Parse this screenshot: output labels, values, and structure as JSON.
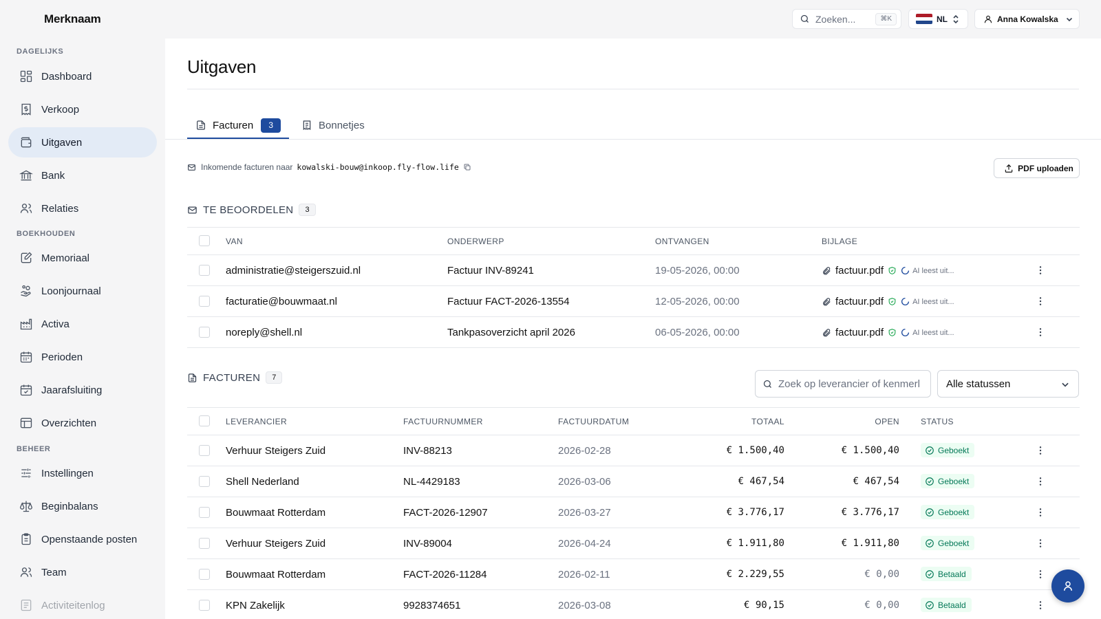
{
  "brand": "Merknaam",
  "topbar": {
    "search_placeholder": "Zoeken...",
    "search_shortcut": "⌘K",
    "language": "NL",
    "user_name": "Anna Kowalska"
  },
  "sidebar": {
    "sections": [
      {
        "title": "DAGELIJKS",
        "items": [
          {
            "label": "Dashboard",
            "icon": "dashboard-icon"
          },
          {
            "label": "Verkoop",
            "icon": "receipt-icon"
          },
          {
            "label": "Uitgaven",
            "icon": "wallet-icon",
            "active": true
          },
          {
            "label": "Bank",
            "icon": "bank-icon"
          },
          {
            "label": "Relaties",
            "icon": "users-icon"
          }
        ]
      },
      {
        "title": "BOEKHOUDEN",
        "items": [
          {
            "label": "Memoriaal",
            "icon": "journal-edit-icon"
          },
          {
            "label": "Loonjournaal",
            "icon": "hand-coins-icon"
          },
          {
            "label": "Activa",
            "icon": "factory-icon"
          },
          {
            "label": "Perioden",
            "icon": "calendar-icon"
          },
          {
            "label": "Jaarafsluiting",
            "icon": "calendar-check-icon"
          },
          {
            "label": "Overzichten",
            "icon": "table-icon"
          }
        ]
      },
      {
        "title": "BEHEER",
        "items": [
          {
            "label": "Instellingen",
            "icon": "sliders-icon"
          },
          {
            "label": "Beginbalans",
            "icon": "scale-icon"
          },
          {
            "label": "Openstaande posten",
            "icon": "clipboard-list-icon"
          },
          {
            "label": "Team",
            "icon": "team-icon"
          },
          {
            "label": "Activiteitenlog",
            "icon": "log-icon"
          }
        ]
      }
    ]
  },
  "page": {
    "title": "Uitgaven",
    "tabs": [
      {
        "label": "Facturen",
        "badge": "3",
        "active": true
      },
      {
        "label": "Bonnetjes"
      }
    ],
    "inbox_label": "Inkomende facturen naar",
    "inbox_email": "kowalski-bouw@inkoop.fly-flow.life",
    "upload_button": "PDF uploaden"
  },
  "review": {
    "title": "TE BEOORDELEN",
    "count": "3",
    "columns": [
      "VAN",
      "ONDERWERP",
      "ONTVANGEN",
      "BIJLAGE"
    ],
    "rows": [
      {
        "from": "administratie@steigerszuid.nl",
        "subject": "Factuur INV-89241",
        "received": "19-05-2026, 00:00",
        "file": "factuur.pdf",
        "ai": "AI leest uit..."
      },
      {
        "from": "facturatie@bouwmaat.nl",
        "subject": "Factuur FACT-2026-13554",
        "received": "12-05-2026, 00:00",
        "file": "factuur.pdf",
        "ai": "AI leest uit..."
      },
      {
        "from": "noreply@shell.nl",
        "subject": "Tankpasoverzicht april 2026",
        "received": "06-05-2026, 00:00",
        "file": "factuur.pdf",
        "ai": "AI leest uit..."
      }
    ]
  },
  "invoices": {
    "title": "FACTUREN",
    "count": "7",
    "search_placeholder": "Zoek op leverancier of kenmerk",
    "status_filter": "Alle statussen",
    "columns": [
      "LEVERANCIER",
      "FACTUURNUMMER",
      "FACTUURDATUM",
      "TOTAAL",
      "OPEN",
      "STATUS"
    ],
    "rows": [
      {
        "supplier": "Verhuur Steigers Zuid",
        "number": "INV-88213",
        "date": "2026-02-28",
        "total": "€ 1.500,40",
        "open": "€ 1.500,40",
        "status": "Geboekt"
      },
      {
        "supplier": "Shell Nederland",
        "number": "NL-4429183",
        "date": "2026-03-06",
        "total": "€ 467,54",
        "open": "€ 467,54",
        "status": "Geboekt"
      },
      {
        "supplier": "Bouwmaat Rotterdam",
        "number": "FACT-2026-12907",
        "date": "2026-03-27",
        "total": "€ 3.776,17",
        "open": "€ 3.776,17",
        "status": "Geboekt"
      },
      {
        "supplier": "Verhuur Steigers Zuid",
        "number": "INV-89004",
        "date": "2026-04-24",
        "total": "€ 1.911,80",
        "open": "€ 1.911,80",
        "status": "Geboekt"
      },
      {
        "supplier": "Bouwmaat Rotterdam",
        "number": "FACT-2026-11284",
        "date": "2026-02-11",
        "total": "€ 2.229,55",
        "open": "€ 0,00",
        "status": "Betaald"
      },
      {
        "supplier": "KPN Zakelijk",
        "number": "9928374651",
        "date": "2026-03-08",
        "total": "€ 90,15",
        "open": "€ 0,00",
        "status": "Betaald"
      }
    ]
  },
  "colors": {
    "accent": "#1e4b9e",
    "sidebar_bg": "#f5f5f6",
    "active_nav": "#e3ebf6",
    "status_green": "#047857"
  }
}
